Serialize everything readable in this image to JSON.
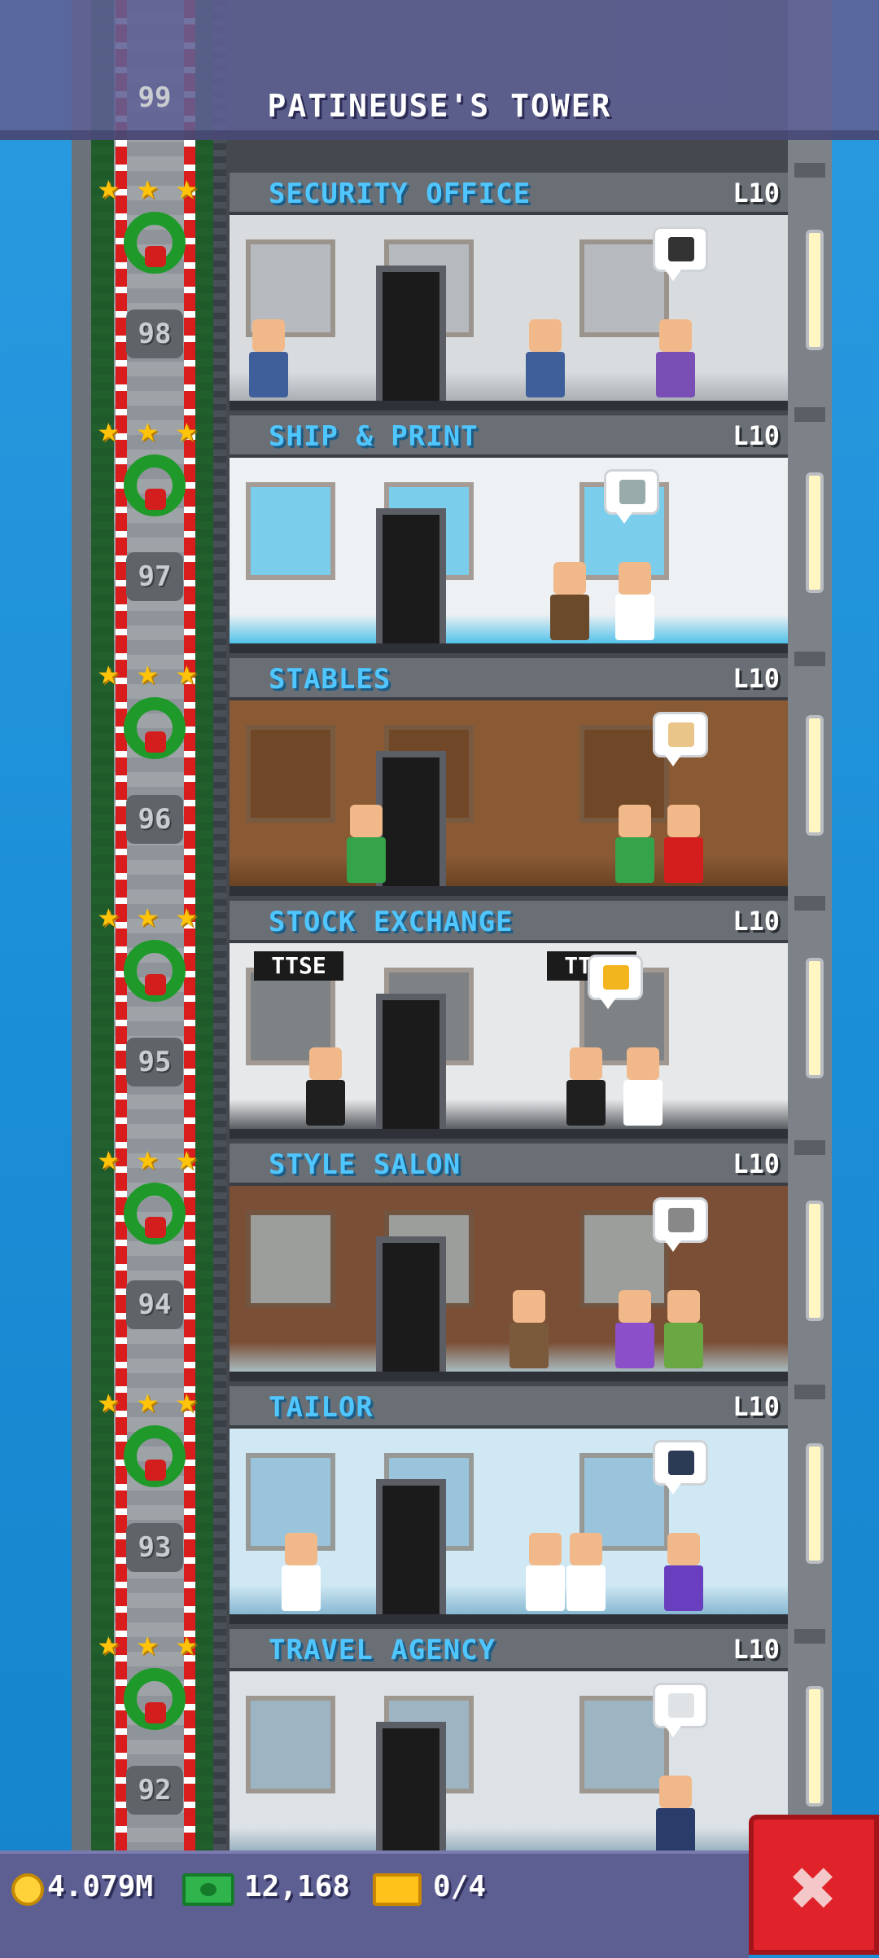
{
  "header": {
    "tower_title": "PATINEUSE'S TOWER",
    "top_floor_number": "99"
  },
  "floors": [
    {
      "name": "SECURITY OFFICE",
      "level": "L10",
      "number": "98",
      "bubble_icon": "walkie-talkie-icon",
      "wall": "#d9dcdf",
      "accent": "#9aa0a6"
    },
    {
      "name": "SHIP & PRINT",
      "level": "L10",
      "number": "97",
      "bubble_icon": "document-icon",
      "wall": "#eef1f3",
      "accent": "#1fb2e6"
    },
    {
      "name": "STABLES",
      "level": "L10",
      "number": "96",
      "bubble_icon": "hay-bale-icon",
      "wall": "#8a5a34",
      "accent": "#5e3a1d"
    },
    {
      "name": "STOCK EXCHANGE",
      "level": "L10",
      "number": "95",
      "bubble_icon": "gold-bars-icon",
      "wall": "#e6e8ea",
      "accent": "#2b2f33",
      "sign_left": "TTSE",
      "sign_right": "TTSE"
    },
    {
      "name": "STYLE SALON",
      "level": "L10",
      "number": "94",
      "bubble_icon": "scissors-icon",
      "wall": "#7a4f36",
      "accent": "#b9e0f0"
    },
    {
      "name": "TAILOR",
      "level": "L10",
      "number": "93",
      "bubble_icon": "shirt-icon",
      "wall": "#cfe8f4",
      "accent": "#6fa8c7"
    },
    {
      "name": "TRAVEL AGENCY",
      "level": "L10",
      "number": "92",
      "bubble_icon": "airplane-icon",
      "wall": "#dde2e6",
      "accent": "#6a8fa8"
    }
  ],
  "currency": {
    "coins": "4.079M",
    "bux": "12,168",
    "tickets": "0/4"
  },
  "close_button": {
    "icon": "close-icon",
    "color": "#e0232a"
  }
}
